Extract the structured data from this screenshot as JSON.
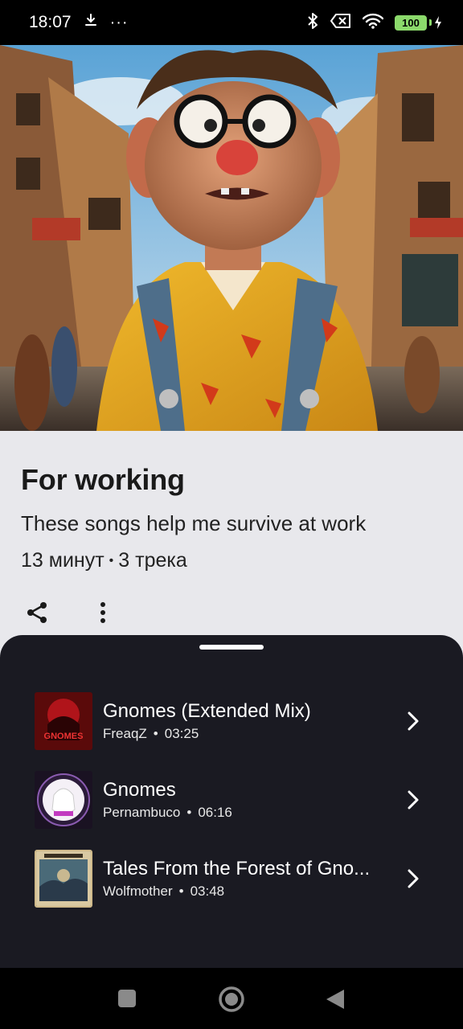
{
  "status_bar": {
    "time": "18:07",
    "more": "···",
    "battery_level": "100"
  },
  "playlist": {
    "title": "For working",
    "description": "These songs help me survive at work",
    "duration": "13 минут",
    "separator": "•",
    "track_count": "3 трека"
  },
  "tracks": [
    {
      "title": "Gnomes (Extended Mix)",
      "artist": "FreaqZ",
      "dot": "•",
      "duration": "03:25",
      "art_label": "GNOMES"
    },
    {
      "title": "Gnomes",
      "artist": "Pernambuco",
      "dot": "•",
      "duration": "06:16",
      "art_label": ""
    },
    {
      "title": "Tales From the Forest of Gno...",
      "artist": "Wolfmother",
      "dot": "•",
      "duration": "03:48",
      "art_label": ""
    }
  ],
  "colors": {
    "background": "#e8e8ec",
    "sheet": "#1a1a22",
    "battery": "#8bd96b"
  }
}
